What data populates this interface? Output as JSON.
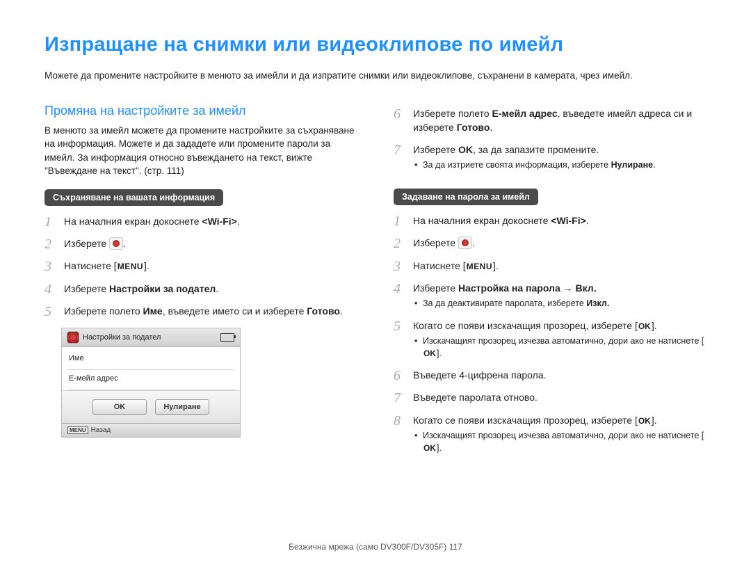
{
  "page_title": "Изпращане на снимки или видеоклипове по имейл",
  "intro": "Можете да промените настройките в менюто за имейли и да изпратите снимки или видеоклипове, съхранени в камерата, чрез имейл.",
  "left": {
    "subhead": "Промяна на настройките за имейл",
    "para": "В менюто за имейл можете да промените настройките за съхраняване на информация. Можете и да зададете или промените пароли за имейл. За информация относно въвеждането на текст, вижте \"Въвеждане на текст\". (стр. 111)",
    "tag": "Съхраняване на вашата информация",
    "steps": {
      "s1_a": "На началния екран докоснете ",
      "s1_b": "<Wi-Fi>",
      "s1_c": ".",
      "s2_a": "Изберете ",
      "s2_c": ".",
      "s3_a": "Натиснете [",
      "s3_menu": "MENU",
      "s3_c": "].",
      "s4_a": "Изберете ",
      "s4_b": "Настройки за подател",
      "s4_c": ".",
      "s5_a": "Изберете полето ",
      "s5_b": "Име",
      "s5_c": ", въведете името си и изберете ",
      "s5_d": "Готово",
      "s5_e": "."
    },
    "screenshot": {
      "title": "Настройки за подател",
      "row1": "Име",
      "row2": "Е-мейл адрес",
      "btn_ok": "OK",
      "btn_reset": "Нулиране",
      "footer_menu": "MENU",
      "footer_back": "Назад"
    }
  },
  "right": {
    "top": {
      "s6_a": "Изберете полето ",
      "s6_b": "Е-мейл адрес",
      "s6_c": ", въведете имейл адреса си и изберете ",
      "s6_d": "Готово",
      "s6_e": ".",
      "s7_a": "Изберете ",
      "s7_b": "OK",
      "s7_c": ", за да запазите промените.",
      "s7_bullet_a": "За да изтриете своята информация, изберете ",
      "s7_bullet_b": "Нулиране",
      "s7_bullet_c": "."
    },
    "tag": "Задаване на парола за имейл",
    "steps": {
      "s1_a": "На началния екран докоснете ",
      "s1_b": "<Wi-Fi>",
      "s1_c": ".",
      "s2_a": "Изберете ",
      "s2_c": ".",
      "s3_a": "Натиснете [",
      "s3_menu": "MENU",
      "s3_c": "].",
      "s4_a": "Изберете ",
      "s4_b": "Настройка на парола",
      "s4_arrow": " → ",
      "s4_c": "Вкл.",
      "s4_bullet_a": "За да деактивирате паролата, изберете ",
      "s4_bullet_b": "Изкл.",
      "s5_a": "Когато се появи изскачащия прозорец, изберете [",
      "s5_ok": "OK",
      "s5_c": "].",
      "s5_bullet_a": "Изскачащият прозорец изчезва автоматично, дори ако не натиснете [",
      "s5_bullet_ok": "OK",
      "s5_bullet_c": "].",
      "s6_a": "Въведете 4-цифрена парола.",
      "s7_a": "Въведете паролата отново.",
      "s8_a": "Когато се появи изскачащия прозорец, изберете [",
      "s8_ok": "OK",
      "s8_c": "].",
      "s8_bullet_a": "Изскачащият прозорец изчезва автоматично, дори ако не натиснете [",
      "s8_bullet_ok": "OK",
      "s8_bullet_c": "]."
    }
  },
  "footer": {
    "text": "Безжична мрежа (само DV300F/DV305F)  ",
    "page": "117"
  }
}
